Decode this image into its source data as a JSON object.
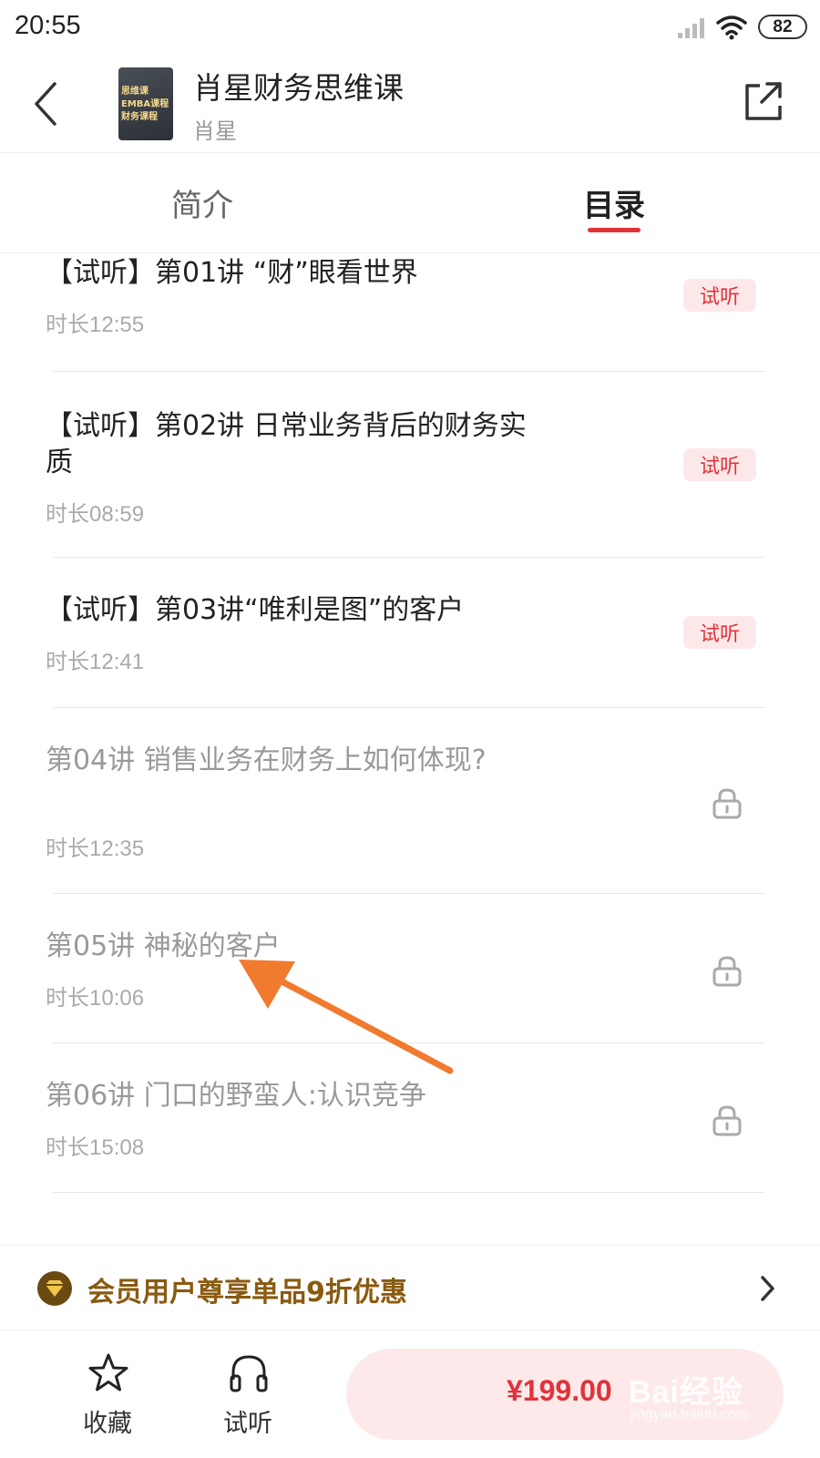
{
  "status_bar": {
    "time": "20:55",
    "battery": "82",
    "icons": [
      "signal-icon",
      "wifi-icon",
      "battery-icon"
    ]
  },
  "header": {
    "title": "肖星财务思维课",
    "author": "肖星",
    "cover_text": "思维课 / EMBA课程 / 财务课程"
  },
  "tabs": [
    {
      "label": "简介",
      "active": false
    },
    {
      "label": "目录",
      "active": true
    }
  ],
  "lessons": [
    {
      "title": "【试听】第01讲 “财”眼看世界",
      "duration": "时长12:55",
      "badge": "试听",
      "locked": false
    },
    {
      "title": "【试听】第02讲 日常业务背后的财务实质",
      "duration": "时长08:59",
      "badge": "试听",
      "locked": false
    },
    {
      "title": "【试听】第03讲“唯利是图”的客户",
      "duration": "时长12:41",
      "badge": "试听",
      "locked": false
    },
    {
      "title": "第04讲 销售业务在财务上如何体现?",
      "duration": "时长12:35",
      "badge": "",
      "locked": true
    },
    {
      "title": "第05讲 神秘的客户",
      "duration": "时长10:06",
      "badge": "",
      "locked": true
    },
    {
      "title": "第06讲 门口的野蛮人:认识竞争",
      "duration": "时长15:08",
      "badge": "",
      "locked": true
    }
  ],
  "member_banner": {
    "text": "会员用户尊享单品9折优惠"
  },
  "bottom_bar": {
    "favorite_label": "收藏",
    "listen_label": "试听",
    "price": "¥199.00"
  },
  "watermark": {
    "main": "Bai经验",
    "sub": "jingyan.baidu.com"
  },
  "colors": {
    "accent": "#e0333a",
    "badge_bg": "#fde8e9",
    "member_gold": "#8a5a10",
    "arrow": "#f07a2e"
  }
}
